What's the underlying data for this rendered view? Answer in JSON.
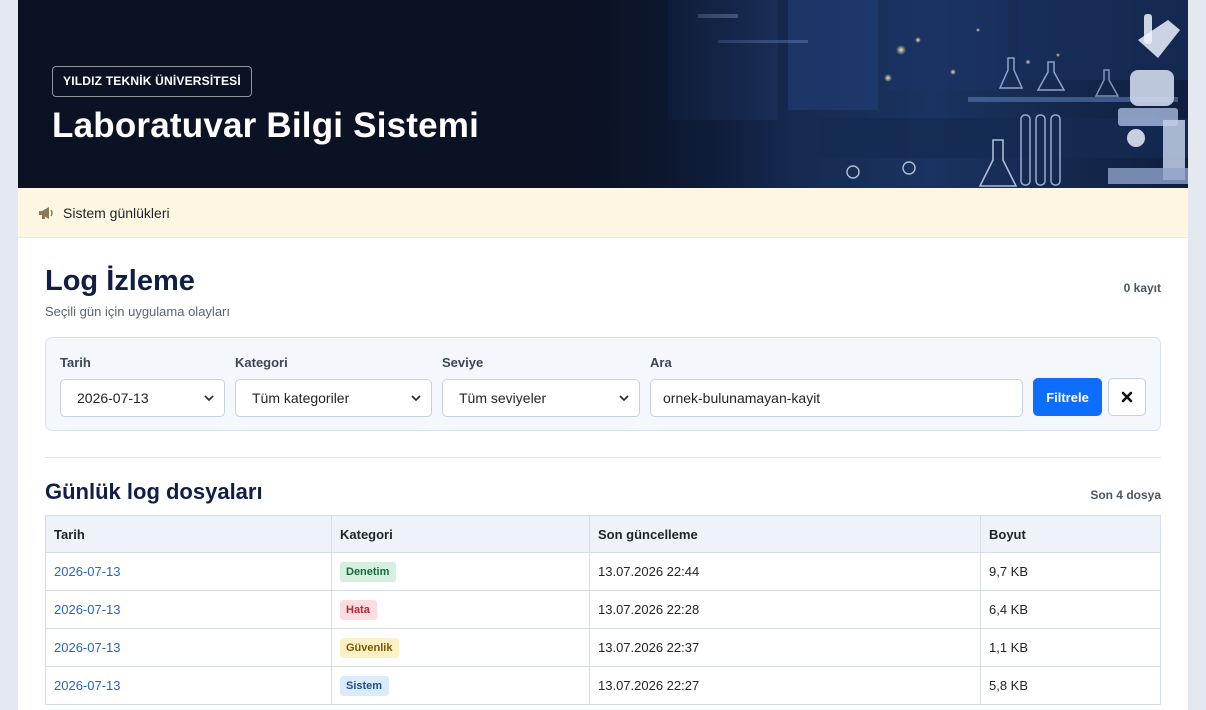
{
  "hero": {
    "university": "YILDIZ TEKNİK ÜNİVERSİTESİ",
    "title": "Laboratuvar Bilgi Sistemi"
  },
  "notice": {
    "icon": "megaphone-icon",
    "text": "Sistem günlükleri"
  },
  "page": {
    "title": "Log İzleme",
    "subtitle": "Seçili gün için uygulama olayları",
    "record_count": "0 kayıt"
  },
  "filters": {
    "date": {
      "label": "Tarih",
      "value": "2026-07-13"
    },
    "category": {
      "label": "Kategori",
      "value": "Tüm kategoriler"
    },
    "level": {
      "label": "Seviye",
      "value": "Tüm seviyeler"
    },
    "search": {
      "label": "Ara",
      "value": "ornek-bulunamayan-kayit"
    },
    "submit_label": "Filtrele",
    "clear_icon": "close-icon"
  },
  "log_files": {
    "title": "Günlük log dosyaları",
    "meta": "Son 4 dosya",
    "columns": [
      "Tarih",
      "Kategori",
      "Son güncelleme",
      "Boyut"
    ],
    "rows": [
      {
        "date": "2026-07-13",
        "category": "Denetim",
        "updated": "13.07.2026 22:44",
        "size": "9,7 KB"
      },
      {
        "date": "2026-07-13",
        "category": "Hata",
        "updated": "13.07.2026 22:28",
        "size": "6,4 KB"
      },
      {
        "date": "2026-07-13",
        "category": "Güvenlik",
        "updated": "13.07.2026 22:37",
        "size": "1,1 KB"
      },
      {
        "date": "2026-07-13",
        "category": "Sistem",
        "updated": "13.07.2026 22:27",
        "size": "5,8 KB"
      }
    ]
  },
  "colors": {
    "accent": "#0d6efd",
    "heading": "#0f1f45",
    "badge_audit_bg": "#d6f0df",
    "badge_audit_fg": "#17693b",
    "badge_error_bg": "#fbdde0",
    "badge_error_fg": "#b02a37",
    "badge_security_bg": "#fdf0c4",
    "badge_security_fg": "#7a5a00",
    "badge_system_bg": "#dcebfb",
    "badge_system_fg": "#1d4f91"
  }
}
